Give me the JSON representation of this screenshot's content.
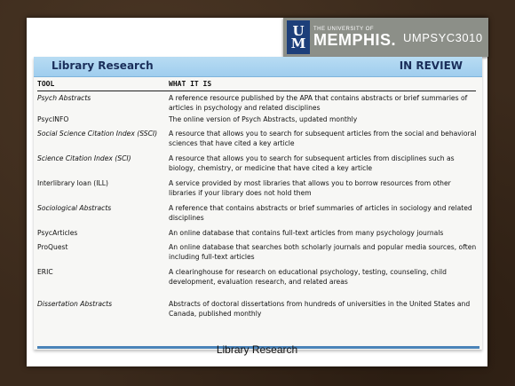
{
  "header": {
    "brand_small": "THE UNIVERSITY OF",
    "brand_name": "MEMPHIS.",
    "course": "UMPSYC3010"
  },
  "table": {
    "banner_title": "Library Research",
    "banner_tag": "IN REVIEW",
    "col_tool": "TOOL",
    "col_what": "WHAT IT IS",
    "rows": [
      {
        "tool": "Psych Abstracts",
        "italic": true,
        "desc": "A reference resource published by the APA that contains abstracts or brief summaries of articles in psychology and related disciplines"
      },
      {
        "tool": "PsycINFO",
        "italic": false,
        "desc": "The online version of Psych Abstracts, updated monthly"
      },
      {
        "tool": "Social Science Citation Index (SSCI)",
        "italic": true,
        "desc": "A resource that allows you to search for subsequent articles from the social and behavioral sciences that have cited a key article"
      },
      {
        "tool": "Science Citation Index (SCI)",
        "italic": true,
        "desc": "A resource that allows you to search for subsequent articles from disciplines such as biology, chemistry, or medicine that have cited a key article"
      },
      {
        "tool": "Interlibrary loan (ILL)",
        "italic": false,
        "desc": "A service provided by most libraries that allows you to borrow resources from other libraries if your library does not hold them"
      },
      {
        "tool": "Sociological Abstracts",
        "italic": true,
        "desc": "A reference that contains abstracts or brief summaries of articles in sociology and related disciplines"
      },
      {
        "tool": "PsycArticles",
        "italic": false,
        "desc": "An online database that contains full-text articles from many psychology journals"
      },
      {
        "tool": "ProQuest",
        "italic": false,
        "desc": "An online database that searches both scholarly journals and popular media sources, often including full-text articles"
      },
      {
        "tool": "ERIC",
        "italic": false,
        "desc": "A clearinghouse for research on educational psychology, testing, counseling, child development, evaluation research, and related areas"
      },
      {
        "tool": "Dissertation Abstracts",
        "italic": true,
        "desc": "Abstracts of doctoral dissertations from hundreds of universities in the United States and Canada, published monthly"
      }
    ]
  },
  "caption": "Library Research"
}
